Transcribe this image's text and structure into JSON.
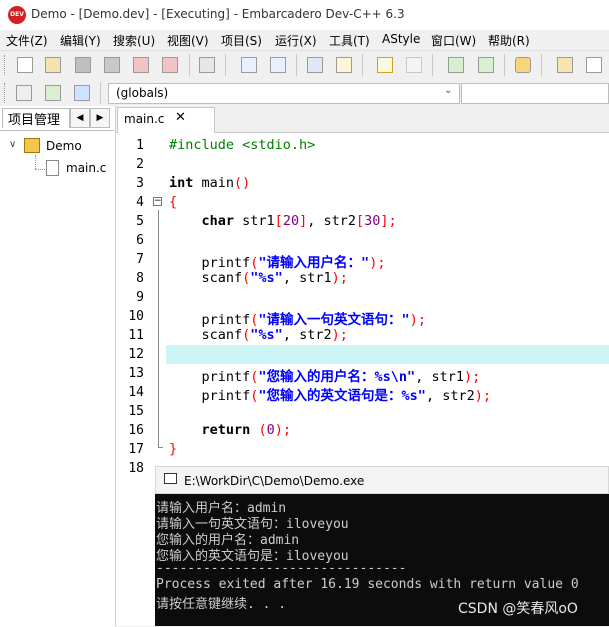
{
  "window": {
    "icon_text": "DEV C++",
    "title": "Demo - [Demo.dev] - [Executing] - Embarcadero Dev-C++ 6.3"
  },
  "menu": [
    "文件(Z)",
    "编辑(Y)",
    "搜索(U)",
    "视图(V)",
    "项目(S)",
    "运行(X)",
    "工具(T)",
    "AStyle",
    "窗口(W)",
    "帮助(R)"
  ],
  "toolbar2": {
    "scope_value": "(globals)"
  },
  "project_panel": {
    "tab_label": "项目管理",
    "tree": {
      "project": "Demo",
      "file": "main.c"
    }
  },
  "editor": {
    "tab_label": "main.c",
    "tab_close": "✕",
    "line_numbers": [
      "1",
      "2",
      "3",
      "4",
      "5",
      "6",
      "7",
      "8",
      "9",
      "10",
      "11",
      "12",
      "13",
      "14",
      "15",
      "16",
      "17",
      "18"
    ],
    "lines": [
      "#include <stdio.h>",
      "",
      "int main()",
      "{",
      "    char str1[20], str2[30];",
      "",
      "    printf(\"请输入用户名：\");",
      "    scanf(\"%s\", str1);",
      "",
      "    printf(\"请输入一句英文语句：\");",
      "    scanf(\"%s\", str2);",
      "",
      "    printf(\"您输入的用户名：%s\\n\", str1);",
      "    printf(\"您输入的英文语句是：%s\", str2);",
      "",
      "    return (0);",
      "}",
      ""
    ],
    "current_line": 12
  },
  "console": {
    "title": "E:\\WorkDir\\C\\Demo\\Demo.exe",
    "lines": [
      "请输入用户名：admin",
      "请输入一句英文语句：iloveyou",
      "您输入的用户名：admin",
      "您输入的英文语句是：iloveyou",
      "--------------------------------",
      "Process exited after 16.19 seconds with return value 0",
      "请按任意键继续. . ."
    ]
  },
  "watermark": "CSDN @笑春风oO",
  "colors": {
    "keyword": "#000000",
    "string": "#0000ff",
    "symbol": "#ff0000",
    "number": "#800080",
    "preprocessor": "#008000",
    "current_line": "#ccf5f5"
  }
}
